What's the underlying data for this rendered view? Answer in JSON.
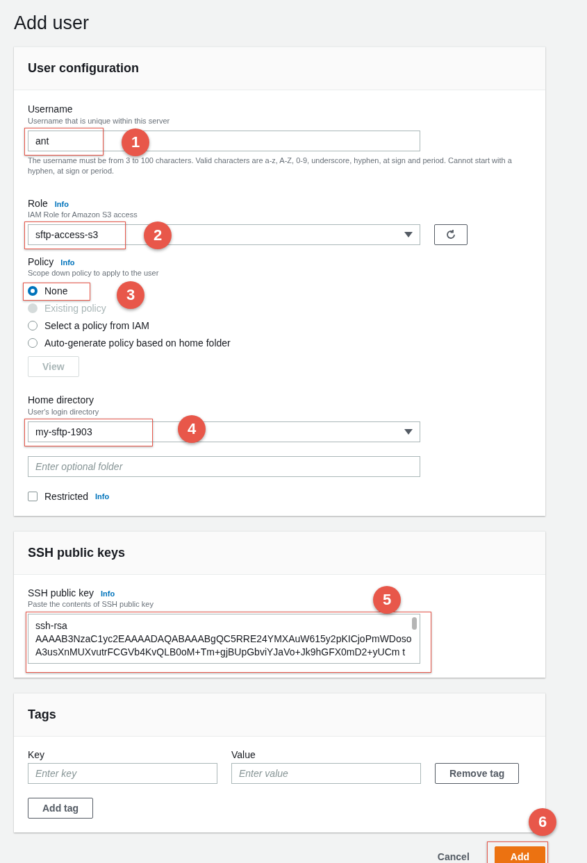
{
  "title": "Add user",
  "user_configuration": {
    "heading": "User configuration",
    "username": {
      "label": "Username",
      "hint": "Username that is unique within this server",
      "value": "ant",
      "callout": "1",
      "constraint": "The username must be from 3 to 100 characters. Valid characters are a-z, A-Z, 0-9, underscore, hyphen, at sign and period. Cannot start with a hyphen, at sign or period."
    },
    "role": {
      "label": "Role",
      "info": "Info",
      "hint": "IAM Role for Amazon S3 access",
      "value": "sftp-access-s3",
      "callout": "2"
    },
    "policy": {
      "label": "Policy",
      "info": "Info",
      "hint": "Scope down policy to apply to the user",
      "callout": "3",
      "options": [
        {
          "label": "None",
          "selected": true,
          "disabled": false
        },
        {
          "label": "Existing policy",
          "selected": false,
          "disabled": true
        },
        {
          "label": "Select a policy from IAM",
          "selected": false,
          "disabled": false
        },
        {
          "label": "Auto-generate policy based on home folder",
          "selected": false,
          "disabled": false
        }
      ],
      "view_button": {
        "label": "View",
        "disabled": true
      }
    },
    "home_directory": {
      "label": "Home directory",
      "hint": "User's login directory",
      "value": "my-sftp-1903",
      "callout": "4",
      "folder_placeholder": "Enter optional folder"
    },
    "restricted": {
      "label": "Restricted",
      "info": "Info",
      "checked": false
    }
  },
  "ssh_keys": {
    "heading": "SSH public keys",
    "label": "SSH public key",
    "info": "Info",
    "hint": "Paste the contents of SSH public key",
    "callout": "5",
    "lines": [
      "ssh-rsa",
      "AAAAB3NzaC1yc2EAAAADAQABAAABgQC5RRE24YMXAuW615y2pKICjoPmWDoso",
      "A3usXnMUXvutrFCGVb4KvQLB0oM+Tm+gjBUpGbviYJaVo+Jk9hGFX0mD2+yUCm t"
    ]
  },
  "tags": {
    "heading": "Tags",
    "key_label": "Key",
    "value_label": "Value",
    "key_placeholder": "Enter key",
    "value_placeholder": "Enter value",
    "remove_button": "Remove tag",
    "add_button": "Add tag"
  },
  "footer": {
    "cancel": "Cancel",
    "add": "Add",
    "callout": "6"
  }
}
